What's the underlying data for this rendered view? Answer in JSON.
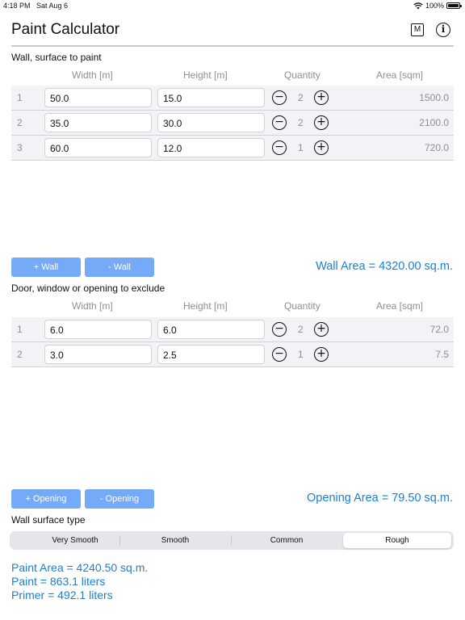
{
  "status": {
    "time": "4:18 PM",
    "date": "Sat Aug 6",
    "battery": "100%",
    "wifi_icon": "wifi-icon",
    "battery_icon": "battery-icon"
  },
  "nav": {
    "title": "Paint Calculator",
    "m_label": "M",
    "info_label": "i"
  },
  "walls": {
    "label": "Wall, surface to paint",
    "headers": {
      "width": "Width [m]",
      "height": "Height [m]",
      "quantity": "Quantity",
      "area": "Area [sqm]"
    },
    "rows": [
      {
        "index": "1",
        "width": "50.0",
        "height": "15.0",
        "qty": "2",
        "area": "1500.0"
      },
      {
        "index": "2",
        "width": "35.0",
        "height": "30.0",
        "qty": "2",
        "area": "2100.0"
      },
      {
        "index": "3",
        "width": "60.0",
        "height": "12.0",
        "qty": "1",
        "area": "720.0"
      }
    ],
    "add_label": "+ Wall",
    "remove_label": "- Wall",
    "total": "Wall Area = 4320.00 sq.m."
  },
  "openings": {
    "label": "Door, window or opening to exclude",
    "headers": {
      "width": "Width [m]",
      "height": "Height [m]",
      "quantity": "Quantity",
      "area": "Area [sqm]"
    },
    "rows": [
      {
        "index": "1",
        "width": "6.0",
        "height": "6.0",
        "qty": "2",
        "area": "72.0"
      },
      {
        "index": "2",
        "width": "3.0",
        "height": "2.5",
        "qty": "1",
        "area": "7.5"
      }
    ],
    "add_label": "+ Opening",
    "remove_label": "- Opening",
    "total": "Opening Area = 79.50 sq.m."
  },
  "surface": {
    "label": "Wall surface type",
    "options": [
      "Very Smooth",
      "Smooth",
      "Common",
      "Rough"
    ],
    "selected": "Rough"
  },
  "results": {
    "paint_area": "Paint Area = 4240.50 sq.m.",
    "paint": "Paint = 863.1 liters",
    "primer": "Primer = 492.1 liters"
  },
  "colors": {
    "accent": "#1a7fd4",
    "button": "#74aaf7",
    "row_bg": "#f2f2f7"
  }
}
